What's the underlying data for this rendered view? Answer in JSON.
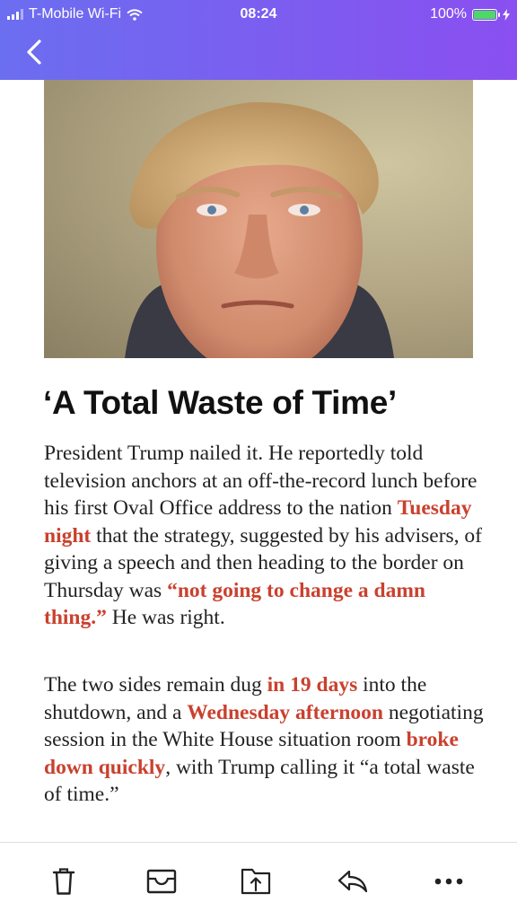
{
  "status_bar": {
    "carrier": "T-Mobile Wi-Fi",
    "time": "08:24",
    "battery": "100%",
    "battery_level": 1.0
  },
  "header": {
    "back_icon": "chevron-left-icon",
    "gradient_colors": [
      "#6b6ef0",
      "#8a4ff0"
    ]
  },
  "article": {
    "image_alt": "photo",
    "headline": "‘A Total Waste of Time’",
    "p1": [
      {
        "text": "President Trump nailed it. He reportedly told television anchors at an off-the-record lunch before his first Oval Office address to the nation "
      },
      {
        "text": "Tuesday night",
        "hl": true
      },
      {
        "text": " that the strategy, suggested by his advisers, of giving a speech and then heading to the border on Thursday was "
      },
      {
        "text": "“not going to change a damn thing.”",
        "hl": true
      },
      {
        "text": " He was right."
      }
    ],
    "p2": [
      {
        "text": "The two sides remain dug "
      },
      {
        "text": "in 19 days",
        "hl": true
      },
      {
        "text": " into the shutdown, and a "
      },
      {
        "text": "Wednesday afternoon",
        "hl": true
      },
      {
        "text": " negotiating session in the White House situation room "
      },
      {
        "text": "broke down quickly",
        "hl": true
      },
      {
        "text": ", with Trump calling it “a total waste of time.”"
      }
    ],
    "highlight_color": "#c9412e"
  },
  "toolbar": {
    "icons": [
      "trash-icon",
      "archive-icon",
      "share-icon",
      "reply-icon",
      "more-icon"
    ]
  }
}
